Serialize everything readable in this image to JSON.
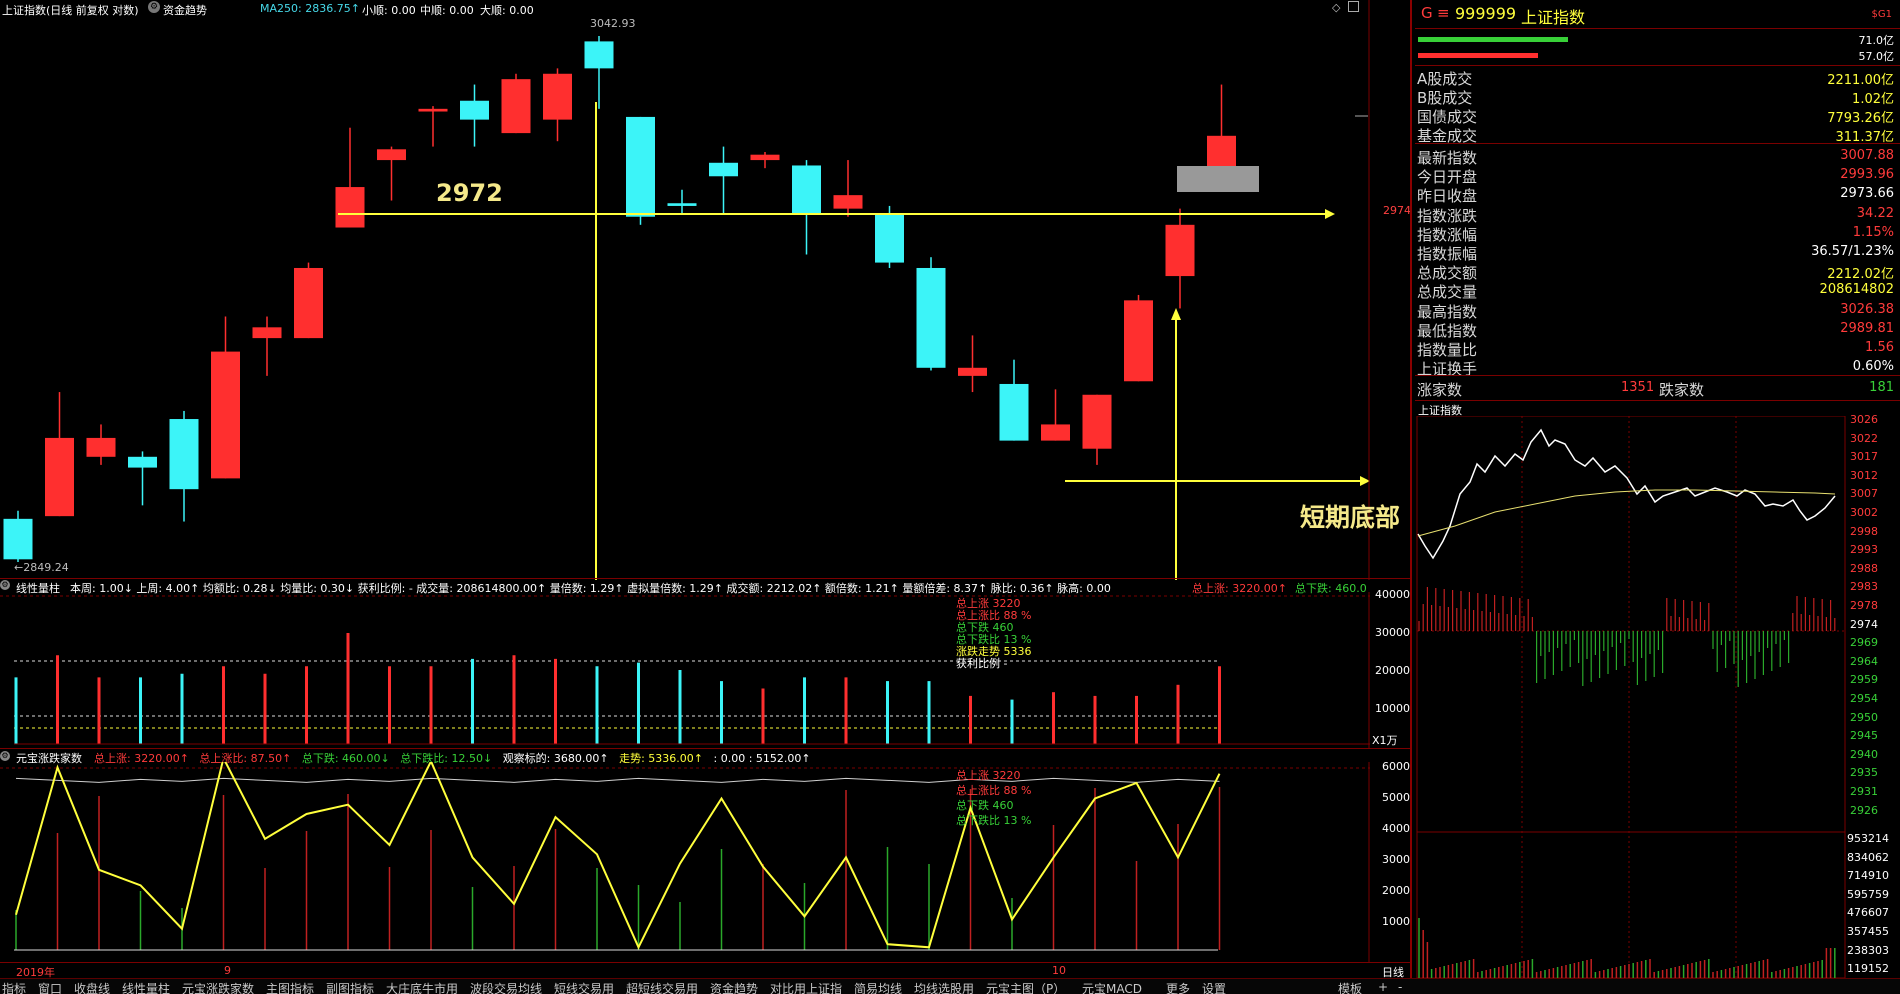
{
  "colors": {
    "up": "#ff2f2f",
    "down": "#3cf4f8",
    "accent_yellow": "#ffff3c",
    "grid": "#7a0000",
    "bg": "#000000"
  },
  "header": {
    "title": "上证指数(日线 前复权 对数)",
    "fund_trend": "资金趋势",
    "ma250": "MA250: 2836.75↑",
    "small_up": "小顺: 0.00",
    "mid_up": "中顺: 0.00",
    "big_up": "大顺: 0.00"
  },
  "main_chart": {
    "high_label": "3042.93",
    "low_label": "←2849.24",
    "line_label": "2972",
    "annotation": "短期底部",
    "price_axis_label": "2974",
    "candles": [
      {
        "o": 2865,
        "c": 2850,
        "h": 2868,
        "l": 2849
      },
      {
        "o": 2866,
        "c": 2895,
        "h": 2912,
        "l": 2866
      },
      {
        "o": 2888,
        "c": 2895,
        "h": 2900,
        "l": 2885
      },
      {
        "o": 2888,
        "c": 2884,
        "h": 2890,
        "l": 2870
      },
      {
        "o": 2902,
        "c": 2876,
        "h": 2905,
        "l": 2864
      },
      {
        "o": 2880,
        "c": 2927,
        "h": 2940,
        "l": 2880
      },
      {
        "o": 2932,
        "c": 2936,
        "h": 2940,
        "l": 2918
      },
      {
        "o": 2932,
        "c": 2958,
        "h": 2960,
        "l": 2932
      },
      {
        "o": 2973,
        "c": 2988,
        "h": 3010,
        "l": 2973
      },
      {
        "o": 2998,
        "c": 3002,
        "h": 3003,
        "l": 2983
      },
      {
        "o": 3016,
        "c": 3017,
        "h": 3018,
        "l": 3003
      },
      {
        "o": 3020,
        "c": 3013,
        "h": 3026,
        "l": 3003
      },
      {
        "o": 3008,
        "c": 3028,
        "h": 3030,
        "l": 3008
      },
      {
        "o": 3013,
        "c": 3030,
        "h": 3032,
        "l": 3005
      },
      {
        "o": 3042,
        "c": 3032,
        "h": 3044,
        "l": 3017
      },
      {
        "o": 3014,
        "c": 2977,
        "h": 3014,
        "l": 2974
      },
      {
        "o": 2982,
        "c": 2981,
        "h": 2987,
        "l": 2978
      },
      {
        "o": 2997,
        "c": 2992,
        "h": 3003,
        "l": 2978
      },
      {
        "o": 2998,
        "c": 3000,
        "h": 3001,
        "l": 2995
      },
      {
        "o": 2996,
        "c": 2978,
        "h": 2998,
        "l": 2963
      },
      {
        "o": 2980,
        "c": 2985,
        "h": 2998,
        "l": 2977
      },
      {
        "o": 2978,
        "c": 2960,
        "h": 2981,
        "l": 2958
      },
      {
        "o": 2958,
        "c": 2921,
        "h": 2962,
        "l": 2920
      },
      {
        "o": 2918,
        "c": 2921,
        "h": 2933,
        "l": 2912
      },
      {
        "o": 2915,
        "c": 2894,
        "h": 2924,
        "l": 2894
      },
      {
        "o": 2894,
        "c": 2900,
        "h": 2913,
        "l": 2894
      },
      {
        "o": 2891,
        "c": 2911,
        "h": 2911,
        "l": 2885
      },
      {
        "o": 2916,
        "c": 2946,
        "h": 2948,
        "l": 2916
      },
      {
        "o": 2955,
        "c": 2974,
        "h": 2980,
        "l": 2943
      },
      {
        "o": 2995,
        "c": 3007,
        "h": 3026,
        "l": 2990
      }
    ]
  },
  "volume_panel": {
    "title": "线性量柱",
    "stats": "本周: 1.00↓  上周: 4.00↑  均额比: 0.28↓  均量比: 0.30↓  获利比例: -  成交量: 208614800.00↑  量倍数: 1.29↑  虚拟量倍数: 1.29↑  成交额: 2212.02↑  额倍数: 1.21↑  量额倍差: 8.37↑  脉比: 0.36↑  脉高: 0.00",
    "total_up": "总上涨: 3220.00↑",
    "total_down": "总下跌: 460.0",
    "legend": [
      "总上涨 3220",
      "总上涨比 88 %",
      "总下跌 460",
      "总下跌比 13 %",
      "涨跌走势 5336",
      "获利比例 -"
    ],
    "axis": [
      "40000",
      "30000",
      "20000",
      "10000"
    ],
    "unit": "X1万",
    "bars": [
      18000,
      24000,
      18000,
      18000,
      19000,
      21000,
      19000,
      21000,
      30000,
      21000,
      21000,
      23000,
      24000,
      23000,
      21000,
      22000,
      20000,
      17000,
      15000,
      18000,
      18000,
      17000,
      17000,
      13000,
      12000,
      14000,
      13000,
      13000,
      16000,
      21000
    ]
  },
  "updown_panel": {
    "title": "元宝涨跌家数",
    "stats": [
      {
        "text": "总上涨: 3220.00↑",
        "color": "red"
      },
      {
        "text": "总上涨比: 87.50↑",
        "color": "red"
      },
      {
        "text": "总下跌: 460.00↓",
        "color": "green"
      },
      {
        "text": "总下跌比: 12.50↓",
        "color": "green"
      },
      {
        "text": "观察标的: 3680.00↑",
        "color": "white"
      },
      {
        "text": "走势: 5336.00↑",
        "color": "yellow"
      },
      {
        "text": ": 0.00  : 5152.00↑",
        "color": "white"
      }
    ],
    "legend": [
      "总上涨 3220",
      "总上涨比 88 %",
      "总下跌 460",
      "总下跌比 13 %"
    ],
    "axis": [
      "6000",
      "5000",
      "4000",
      "3000",
      "2000",
      "1000"
    ],
    "trend": [
      750,
      5500,
      2200,
      1700,
      300,
      5800,
      3200,
      4000,
      4300,
      3000,
      5700,
      2600,
      1100,
      3900,
      2700,
      -300,
      2400,
      4500,
      2300,
      700,
      2600,
      -200,
      -300,
      4200,
      600,
      2600,
      4500,
      5000,
      2600,
      5300
    ]
  },
  "time_axis": {
    "label_2019": "2019年",
    "label_9": "9",
    "label_10": "10",
    "period": "日线"
  },
  "side": {
    "header": {
      "flag": "G",
      "menu": "≡",
      "code": "999999",
      "name": "上证指数",
      "badge": "$G1"
    },
    "bars_values": [
      "71.0亿",
      "57.0亿"
    ],
    "turnover": [
      {
        "label": "A股成交",
        "value": "2211.00亿",
        "color": "yellow"
      },
      {
        "label": "B股成交",
        "value": "1.02亿",
        "color": "yellow"
      },
      {
        "label": "国债成交",
        "value": "7793.26亿",
        "color": "yellow"
      },
      {
        "label": "基金成交",
        "value": "311.37亿",
        "color": "yellow"
      }
    ],
    "index_info": [
      {
        "label": "最新指数",
        "value": "3007.88",
        "color": "red"
      },
      {
        "label": "今日开盘",
        "value": "2993.96",
        "color": "red"
      },
      {
        "label": "昨日收盘",
        "value": "2973.66",
        "color": "white"
      },
      {
        "label": "指数涨跌",
        "value": "34.22",
        "color": "red"
      },
      {
        "label": "指数涨幅",
        "value": "1.15%",
        "color": "red"
      },
      {
        "label": "指数振幅",
        "value": "36.57/1.23%",
        "color": "white"
      },
      {
        "label": "总成交额",
        "value": "2212.02亿",
        "color": "yellow"
      },
      {
        "label": "总成交量",
        "value": "208614802",
        "color": "yellow"
      },
      {
        "label": "最高指数",
        "value": "3026.38",
        "color": "red"
      },
      {
        "label": "最低指数",
        "value": "2989.81",
        "color": "red"
      },
      {
        "label": "指数量比",
        "value": "1.56",
        "color": "red"
      },
      {
        "label": "上证换手",
        "value": "0.60%",
        "color": "white"
      }
    ],
    "breadth": {
      "up_label": "涨家数",
      "up_value": "1351",
      "down_label": "跌家数",
      "down_value": "181"
    },
    "intraday_title": "上证指数",
    "price_axis": [
      "3026",
      "3022",
      "3017",
      "3012",
      "3007",
      "3002",
      "2998",
      "2993",
      "2988",
      "2983",
      "2978",
      "2974",
      "2969",
      "2964",
      "2959",
      "2954",
      "2950",
      "2945",
      "2940",
      "2935",
      "2931",
      "2926"
    ],
    "vol_axis": [
      "953214",
      "834062",
      "714910",
      "595759",
      "476607",
      "357455",
      "238303",
      "119152"
    ]
  },
  "tabs": [
    "指标",
    "窗口",
    "收盘线",
    "线性量柱",
    "元宝涨跌家数",
    "主图指标",
    "副图指标",
    "大庄底牛市用",
    "波段交易均线",
    "短线交易用",
    "超短线交易用",
    "资金趋势",
    "对比用上证指",
    "简易均线",
    "均线选股用",
    "元宝主图（P）",
    "元宝MACD",
    "更多",
    "设置",
    "模板",
    "+",
    "-"
  ]
}
